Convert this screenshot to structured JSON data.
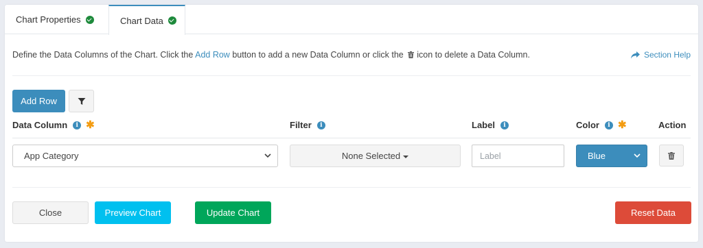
{
  "tabs": [
    {
      "label": "Chart Properties"
    },
    {
      "label": "Chart Data"
    }
  ],
  "intro": {
    "part1": "Define the Data Columns of the Chart. Click the ",
    "link": "Add Row",
    "part2": " button to add a new Data Column or click the ",
    "part3": "icon to delete a Data Column."
  },
  "help_label": "Section Help",
  "toolbar": {
    "add_row_label": "Add Row"
  },
  "headers": {
    "data_column": "Data Column",
    "filter": "Filter",
    "label": "Label",
    "color": "Color",
    "action": "Action"
  },
  "row": {
    "data_column_value": "App Category",
    "filter_value": "None Selected",
    "label_placeholder": "Label",
    "label_value": "",
    "color_value": "Blue"
  },
  "footer": {
    "close_label": "Close",
    "preview_label": "Preview Chart",
    "update_label": "Update Chart",
    "reset_label": "Reset Data"
  },
  "colors": {
    "primary": "#3c8dbc",
    "success": "#00a65a",
    "info": "#00c0ef",
    "danger": "#dd4b39",
    "required": "#f39c12"
  }
}
